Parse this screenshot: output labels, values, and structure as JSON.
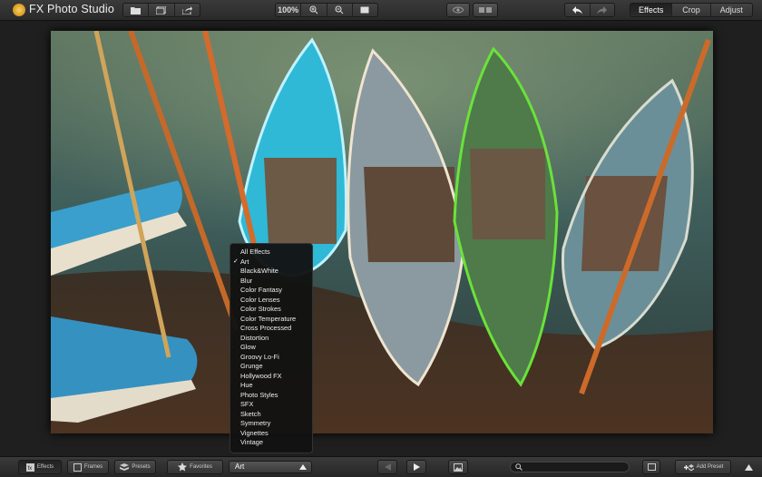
{
  "app": {
    "title": "FX Photo Studio"
  },
  "toolbar": {
    "zoom": "100%",
    "tabs": [
      {
        "label": "Effects",
        "active": true
      },
      {
        "label": "Crop",
        "active": false
      },
      {
        "label": "Adjust",
        "active": false
      }
    ]
  },
  "effects_menu": {
    "items": [
      {
        "label": "All Effects",
        "checked": false
      },
      {
        "label": "Art",
        "checked": true
      },
      {
        "label": "Black&White",
        "checked": false
      },
      {
        "label": "Blur",
        "checked": false
      },
      {
        "label": "Color Fantasy",
        "checked": false
      },
      {
        "label": "Color Lenses",
        "checked": false
      },
      {
        "label": "Color Strokes",
        "checked": false
      },
      {
        "label": "Color Temperature",
        "checked": false
      },
      {
        "label": "Cross Processed",
        "checked": false
      },
      {
        "label": "Distortion",
        "checked": false
      },
      {
        "label": "Glow",
        "checked": false
      },
      {
        "label": "Groovy Lo-Fi",
        "checked": false
      },
      {
        "label": "Grunge",
        "checked": false
      },
      {
        "label": "Hollywood FX",
        "checked": false
      },
      {
        "label": "Hue",
        "checked": false
      },
      {
        "label": "Photo Styles",
        "checked": false
      },
      {
        "label": "SFX",
        "checked": false
      },
      {
        "label": "Sketch",
        "checked": false
      },
      {
        "label": "Symmetry",
        "checked": false
      },
      {
        "label": "Vignettes",
        "checked": false
      },
      {
        "label": "Vintage",
        "checked": false
      }
    ],
    "check_mark": "✓"
  },
  "bottom": {
    "effects_label": "Effects",
    "frames_label": "Frames",
    "presets_label": "Presets",
    "favorites_label": "Favorites",
    "category_selected": "Art",
    "add_preset_label": "Add Preset"
  },
  "colors": {
    "accent": "#e0a52a",
    "bg": "#1f1f1f"
  }
}
